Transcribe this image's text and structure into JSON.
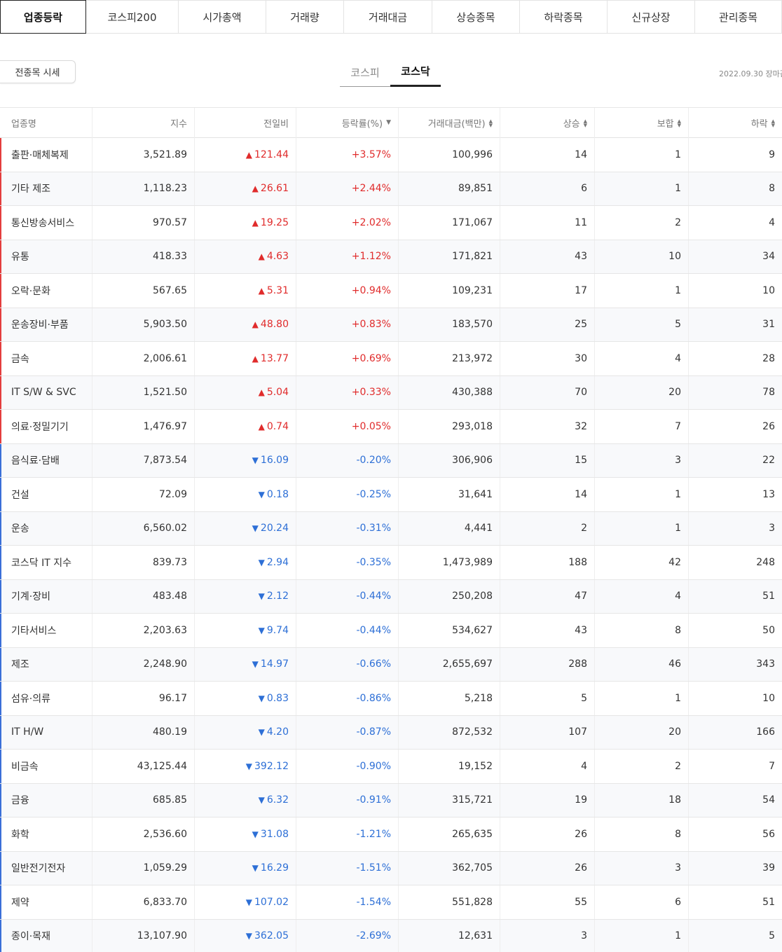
{
  "tabs": [
    {
      "label": "업종등락",
      "active": true
    },
    {
      "label": "코스피200",
      "active": false
    },
    {
      "label": "시가총액",
      "active": false
    },
    {
      "label": "거래량",
      "active": false
    },
    {
      "label": "거래대금",
      "active": false
    },
    {
      "label": "상승종목",
      "active": false
    },
    {
      "label": "하락종목",
      "active": false
    },
    {
      "label": "신규상장",
      "active": false
    },
    {
      "label": "관리종목",
      "active": false
    }
  ],
  "all_button": "전종목 시세",
  "market_tabs": [
    {
      "label": "코스피",
      "active": false
    },
    {
      "label": "코스닥",
      "active": true
    }
  ],
  "date": "2022.09.30 장마감",
  "columns": [
    "업종명",
    "지수",
    "전일비",
    "등락률(%)",
    "거래대금(백만)",
    "상승",
    "보합",
    "하락"
  ],
  "colors": {
    "up": "#e02b2b",
    "down": "#2d6fd6"
  },
  "rows": [
    {
      "name": "출판·매체복제",
      "index": "3,521.89",
      "change": "121.44",
      "rate": "+3.57%",
      "amount": "100,996",
      "rise": "14",
      "flat": "1",
      "fall": "9",
      "dir": "up"
    },
    {
      "name": "기타 제조",
      "index": "1,118.23",
      "change": "26.61",
      "rate": "+2.44%",
      "amount": "89,851",
      "rise": "6",
      "flat": "1",
      "fall": "8",
      "dir": "up"
    },
    {
      "name": "통신방송서비스",
      "index": "970.57",
      "change": "19.25",
      "rate": "+2.02%",
      "amount": "171,067",
      "rise": "11",
      "flat": "2",
      "fall": "4",
      "dir": "up"
    },
    {
      "name": "유통",
      "index": "418.33",
      "change": "4.63",
      "rate": "+1.12%",
      "amount": "171,821",
      "rise": "43",
      "flat": "10",
      "fall": "34",
      "dir": "up"
    },
    {
      "name": "오락·문화",
      "index": "567.65",
      "change": "5.31",
      "rate": "+0.94%",
      "amount": "109,231",
      "rise": "17",
      "flat": "1",
      "fall": "10",
      "dir": "up"
    },
    {
      "name": "운송장비·부품",
      "index": "5,903.50",
      "change": "48.80",
      "rate": "+0.83%",
      "amount": "183,570",
      "rise": "25",
      "flat": "5",
      "fall": "31",
      "dir": "up"
    },
    {
      "name": "금속",
      "index": "2,006.61",
      "change": "13.77",
      "rate": "+0.69%",
      "amount": "213,972",
      "rise": "30",
      "flat": "4",
      "fall": "28",
      "dir": "up"
    },
    {
      "name": "IT S/W & SVC",
      "index": "1,521.50",
      "change": "5.04",
      "rate": "+0.33%",
      "amount": "430,388",
      "rise": "70",
      "flat": "20",
      "fall": "78",
      "dir": "up"
    },
    {
      "name": "의료·정밀기기",
      "index": "1,476.97",
      "change": "0.74",
      "rate": "+0.05%",
      "amount": "293,018",
      "rise": "32",
      "flat": "7",
      "fall": "26",
      "dir": "up"
    },
    {
      "name": "음식료·담배",
      "index": "7,873.54",
      "change": "16.09",
      "rate": "-0.20%",
      "amount": "306,906",
      "rise": "15",
      "flat": "3",
      "fall": "22",
      "dir": "down"
    },
    {
      "name": "건설",
      "index": "72.09",
      "change": "0.18",
      "rate": "-0.25%",
      "amount": "31,641",
      "rise": "14",
      "flat": "1",
      "fall": "13",
      "dir": "down"
    },
    {
      "name": "운송",
      "index": "6,560.02",
      "change": "20.24",
      "rate": "-0.31%",
      "amount": "4,441",
      "rise": "2",
      "flat": "1",
      "fall": "3",
      "dir": "down"
    },
    {
      "name": "코스닥 IT 지수",
      "index": "839.73",
      "change": "2.94",
      "rate": "-0.35%",
      "amount": "1,473,989",
      "rise": "188",
      "flat": "42",
      "fall": "248",
      "dir": "down"
    },
    {
      "name": "기계·장비",
      "index": "483.48",
      "change": "2.12",
      "rate": "-0.44%",
      "amount": "250,208",
      "rise": "47",
      "flat": "4",
      "fall": "51",
      "dir": "down"
    },
    {
      "name": "기타서비스",
      "index": "2,203.63",
      "change": "9.74",
      "rate": "-0.44%",
      "amount": "534,627",
      "rise": "43",
      "flat": "8",
      "fall": "50",
      "dir": "down"
    },
    {
      "name": "제조",
      "index": "2,248.90",
      "change": "14.97",
      "rate": "-0.66%",
      "amount": "2,655,697",
      "rise": "288",
      "flat": "46",
      "fall": "343",
      "dir": "down"
    },
    {
      "name": "섬유·의류",
      "index": "96.17",
      "change": "0.83",
      "rate": "-0.86%",
      "amount": "5,218",
      "rise": "5",
      "flat": "1",
      "fall": "10",
      "dir": "down"
    },
    {
      "name": "IT H/W",
      "index": "480.19",
      "change": "4.20",
      "rate": "-0.87%",
      "amount": "872,532",
      "rise": "107",
      "flat": "20",
      "fall": "166",
      "dir": "down"
    },
    {
      "name": "비금속",
      "index": "43,125.44",
      "change": "392.12",
      "rate": "-0.90%",
      "amount": "19,152",
      "rise": "4",
      "flat": "2",
      "fall": "7",
      "dir": "down"
    },
    {
      "name": "금융",
      "index": "685.85",
      "change": "6.32",
      "rate": "-0.91%",
      "amount": "315,721",
      "rise": "19",
      "flat": "18",
      "fall": "54",
      "dir": "down"
    },
    {
      "name": "화학",
      "index": "2,536.60",
      "change": "31.08",
      "rate": "-1.21%",
      "amount": "265,635",
      "rise": "26",
      "flat": "8",
      "fall": "56",
      "dir": "down"
    },
    {
      "name": "일반전기전자",
      "index": "1,059.29",
      "change": "16.29",
      "rate": "-1.51%",
      "amount": "362,705",
      "rise": "26",
      "flat": "3",
      "fall": "39",
      "dir": "down"
    },
    {
      "name": "제약",
      "index": "6,833.70",
      "change": "107.02",
      "rate": "-1.54%",
      "amount": "551,828",
      "rise": "55",
      "flat": "6",
      "fall": "51",
      "dir": "down"
    },
    {
      "name": "종이·목재",
      "index": "13,107.90",
      "change": "362.05",
      "rate": "-2.69%",
      "amount": "12,631",
      "rise": "3",
      "flat": "1",
      "fall": "5",
      "dir": "down"
    }
  ]
}
